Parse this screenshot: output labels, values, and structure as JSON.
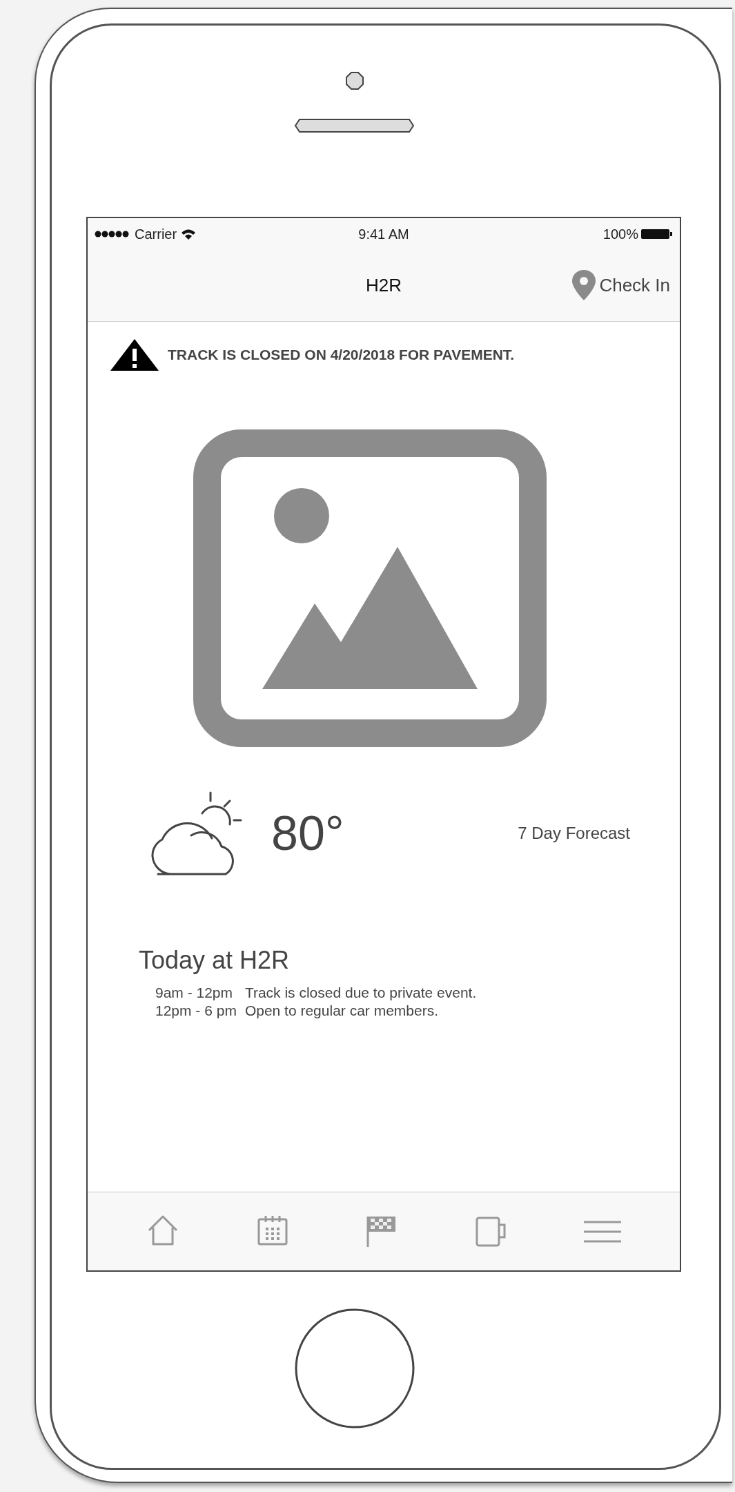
{
  "status_bar": {
    "carrier": "Carrier",
    "time": "9:41 AM",
    "battery": "100%"
  },
  "nav_bar": {
    "title": "H2R",
    "action": "Check In"
  },
  "alert": {
    "text": "TRACK IS CLOSED ON 4/20/2018 FOR PAVEMENT."
  },
  "weather": {
    "temperature": "80°",
    "forecast_link": "7 Day Forecast"
  },
  "today": {
    "heading": "Today at H2R",
    "schedule": [
      {
        "time": "9am - 12pm",
        "description": "Track is closed due to private event."
      },
      {
        "time": "12pm - 6 pm",
        "description": "Open to regular car members."
      }
    ]
  },
  "tab_bar": [
    {
      "kind": "home"
    },
    {
      "kind": "calendar"
    },
    {
      "kind": "flag"
    },
    {
      "kind": "mug"
    },
    {
      "kind": "menu"
    }
  ]
}
